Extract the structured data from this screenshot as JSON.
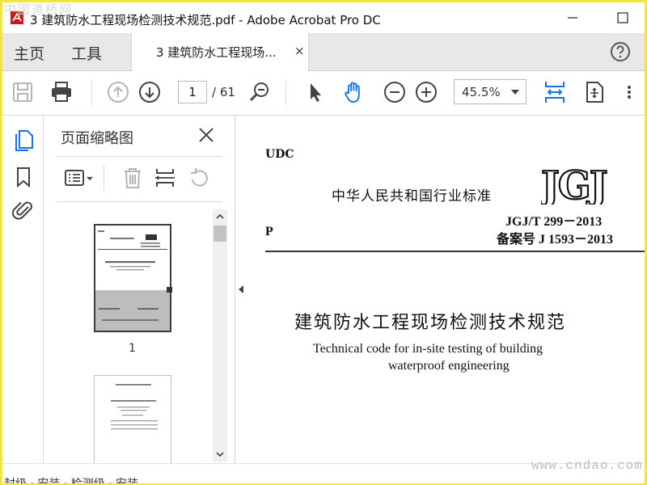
{
  "window": {
    "title": "3 建筑防水工程现场检测技术规范.pdf - Adobe Acrobat Pro DC",
    "watermark_top": "中国道桥网",
    "watermark_bottom": "www.cndao.com",
    "frame_color": "#f2e63a"
  },
  "tabs": {
    "home": "主页",
    "tools": "工具",
    "document": "3 建筑防水工程现场...",
    "close_glyph": "×"
  },
  "toolbar": {
    "page_current": "1",
    "page_total": "/ 61",
    "zoom": "45.5%",
    "active_color": "#1473e6"
  },
  "thumbnails_panel": {
    "title": "页面缩略图",
    "pages": [
      {
        "label": "1",
        "selected": true
      },
      {
        "label": "",
        "selected": false
      }
    ]
  },
  "document": {
    "udc": "UDC",
    "standard_cn": "中华人民共和国行业标准",
    "logo": "JGJ",
    "code": "JGJ/T 299－2013",
    "record_no": "备案号 J 1593－2013",
    "p": "P",
    "title_cn": "建筑防水工程现场检测技术规范",
    "title_en_line1": "Technical code for in-site testing of building",
    "title_en_line2": "waterproof engineering"
  },
  "bottom_cut_text": "封级 · 安装 · 检测级 · 安装"
}
